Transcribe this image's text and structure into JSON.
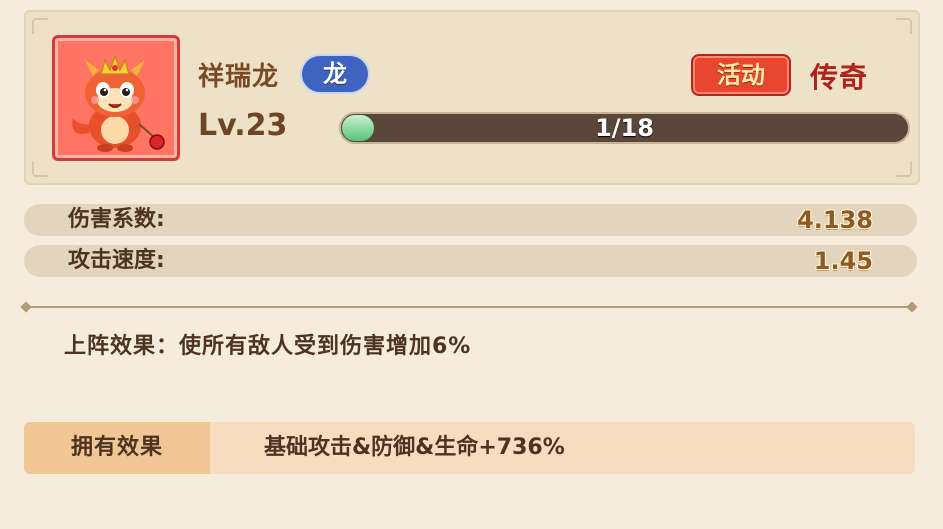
{
  "hero": {
    "name": "祥瑞龙",
    "type_badge": "龙",
    "event_badge": "活动",
    "rarity": "传奇",
    "level": "Lv.23",
    "xp_text": "1/18",
    "xp_progress": 0.056,
    "portrait_icon": "dragon-mascot-icon"
  },
  "stats": [
    {
      "label": "伤害系数:",
      "value": "4.138"
    },
    {
      "label": "攻击速度:",
      "value": "1.45"
    }
  ],
  "effects": {
    "deploy_text": "上阵效果：使所有敌人受到伤害增加6%",
    "own_label": "拥有效果",
    "own_value": "基础攻击&防御&生命+736%"
  },
  "colors": {
    "rarity": "#b2221c",
    "type_badge": "#3f63c0",
    "event_badge": "#e9462f",
    "xp_fill": "#56c27a"
  }
}
